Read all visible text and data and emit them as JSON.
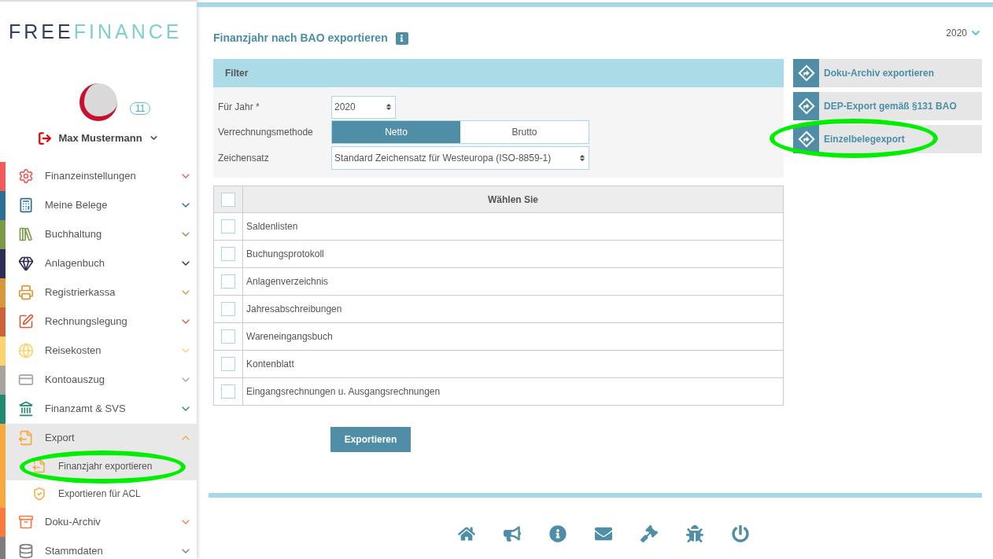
{
  "logo": {
    "part_1": "FREE",
    "part_2": "FINANCE"
  },
  "user": {
    "badge": "11",
    "name": "Max Mustermann"
  },
  "sidebar": {
    "items": [
      {
        "label": "Finanzeinstellungen",
        "color": "#f25a5a",
        "expanded": false
      },
      {
        "label": "Meine Belege",
        "color": "#2a6f97",
        "expanded": false
      },
      {
        "label": "Buchhaltung",
        "color": "#7a9a45",
        "expanded": false
      },
      {
        "label": "Anlagenbuch",
        "color": "#2c2c54",
        "expanded": false
      },
      {
        "label": "Registrierkassa",
        "color": "#d9963a",
        "expanded": false
      },
      {
        "label": "Rechnungslegung",
        "color": "#d0603a",
        "expanded": false
      },
      {
        "label": "Reisekosten",
        "color": "#fcd36e",
        "expanded": false
      },
      {
        "label": "Kontoauszug",
        "color": "#a8a39c",
        "expanded": false
      },
      {
        "label": "Finanzamt & SVS",
        "color": "#1f8a70",
        "expanded": false
      },
      {
        "label": "Export",
        "color": "#f9a73e",
        "expanded": true,
        "children": [
          {
            "label": "Finanzjahr exportieren",
            "selected": true
          },
          {
            "label": "Exportieren für ACL",
            "selected": false
          }
        ]
      },
      {
        "label": "Doku-Archiv",
        "color": "#f9793e",
        "expanded": false
      },
      {
        "label": "Stammdaten",
        "color": "#7d7d7d",
        "expanded": false
      }
    ]
  },
  "page": {
    "title": "Finanzjahr nach BAO exportieren",
    "year_selector": "2020"
  },
  "filter": {
    "title": "Filter",
    "year": {
      "label": "Für Jahr *",
      "value": "2020"
    },
    "method": {
      "label": "Verrechnungsmethode",
      "options": [
        {
          "label": "Netto",
          "selected": true
        },
        {
          "label": "Brutto",
          "selected": false
        }
      ]
    },
    "charset": {
      "label": "Zeichensatz",
      "value": "Standard Zeichensatz für Westeuropa (ISO-8859-1)"
    }
  },
  "table": {
    "header_checked": false,
    "column": "Wählen Sie",
    "rows": [
      {
        "label": "Saldenlisten",
        "checked": false
      },
      {
        "label": "Buchungsprotokoll",
        "checked": false
      },
      {
        "label": "Anlagenverzeichnis",
        "checked": false
      },
      {
        "label": "Jahresabschreibungen",
        "checked": false
      },
      {
        "label": "Wareneingangsbuch",
        "checked": false
      },
      {
        "label": "Kontenblatt",
        "checked": false
      },
      {
        "label": "Eingangsrechnungen u. Ausgangsrechnungen",
        "checked": false
      }
    ]
  },
  "export_button": "Exportieren",
  "actions": [
    {
      "label": "Doku-Archiv exportieren",
      "highlighted": false
    },
    {
      "label": "DEP-Export gemäß §131 BAO",
      "highlighted": false
    },
    {
      "label": "Einzelbelegexport",
      "highlighted": true
    }
  ]
}
